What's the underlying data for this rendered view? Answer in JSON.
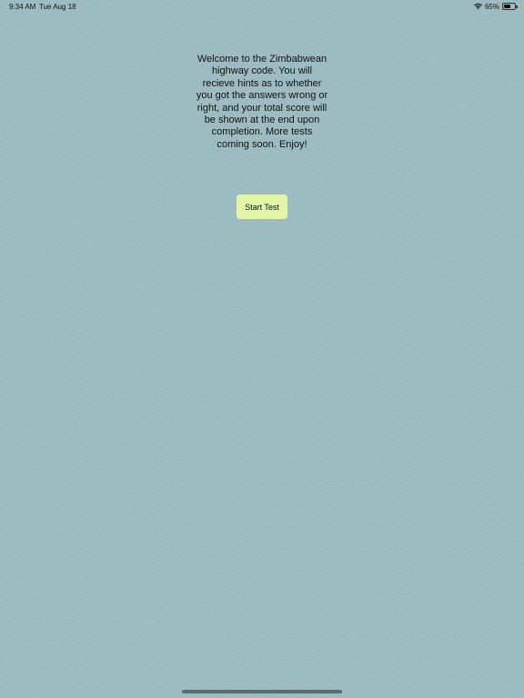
{
  "status_bar": {
    "time": "9:34 AM",
    "date": "Tue Aug 18",
    "battery_percent": "65%",
    "battery_level": 0.65,
    "wifi_icon": "wifi-icon",
    "battery_icon": "battery-icon"
  },
  "main": {
    "welcome_text": "Welcome to the Zimbabwean highway code. You will recieve hints as to whether you got the answers wrong or right, and your total score will be shown at the end upon completion. More tests coming soon. Enjoy!",
    "start_button_label": "Start Test"
  },
  "colors": {
    "background": "#9dbcc2",
    "button_background": "#e3f5a6"
  }
}
